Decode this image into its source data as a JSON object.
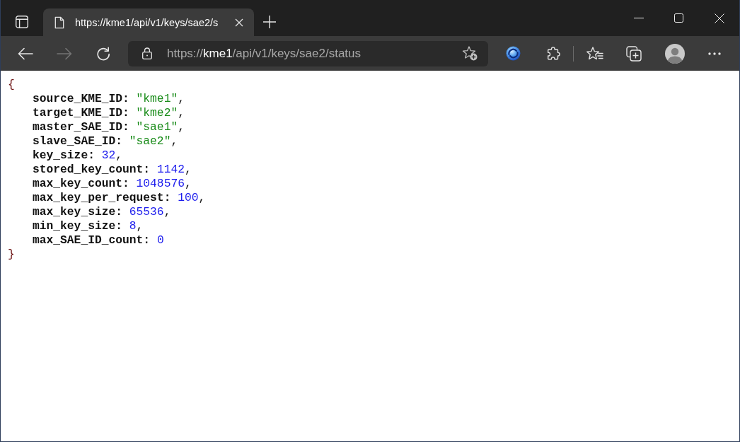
{
  "tabs": [
    {
      "title": "https://kme1/api/v1/keys/sae2/s",
      "selected": true
    }
  ],
  "toolbar": {
    "nav_buttons": [
      {
        "kind": "back",
        "disabled": false
      },
      {
        "kind": "forward",
        "disabled": true
      },
      {
        "kind": "refresh",
        "disabled": false
      }
    ],
    "address": "https://**kme1**/api/v1/keys/sae2/status"
  },
  "json_view": {
    "open": "{",
    "entries": [
      {
        "key": "source_KME_ID:",
        "value": "\"kme1\"",
        "kind": "string",
        "separator": ","
      },
      {
        "key": "target_KME_ID:",
        "value": "\"kme2\"",
        "kind": "string",
        "separator": ","
      },
      {
        "key": "master_SAE_ID:",
        "value": "\"sae1\"",
        "kind": "string",
        "separator": ","
      },
      {
        "key": "slave_SAE_ID:",
        "value": "\"sae2\"",
        "kind": "string",
        "separator": ","
      },
      {
        "key": "key_size:",
        "value": "32",
        "kind": "number",
        "separator": ","
      },
      {
        "key": "stored_key_count:",
        "value": "1142",
        "kind": "number",
        "separator": ","
      },
      {
        "key": "max_key_count:",
        "value": "1048576",
        "kind": "number",
        "separator": ","
      },
      {
        "key": "max_key_per_request:",
        "value": "100",
        "kind": "number",
        "separator": ","
      },
      {
        "key": "max_key_size:",
        "value": "65536",
        "kind": "number",
        "separator": ","
      },
      {
        "key": "min_key_size:",
        "value": "8",
        "kind": "number",
        "separator": ","
      },
      {
        "key": "max_SAE_ID_count:",
        "value": "0",
        "kind": "number"
      }
    ],
    "close": "}"
  }
}
